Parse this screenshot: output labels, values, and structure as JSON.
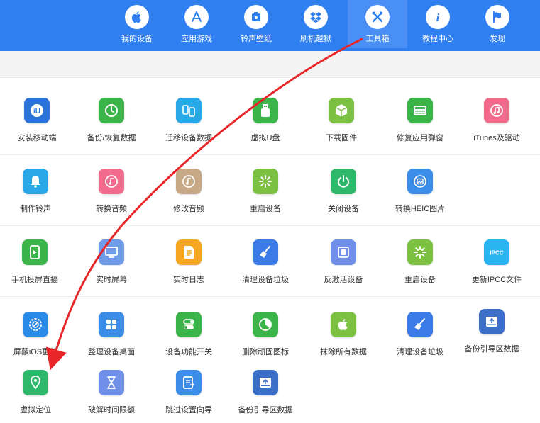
{
  "nav": {
    "tabs": [
      {
        "label": "我的设备",
        "icon": "apple-icon",
        "active": false
      },
      {
        "label": "应用游戏",
        "icon": "app-store-icon",
        "active": false
      },
      {
        "label": "铃声壁纸",
        "icon": "ringtone-icon",
        "active": false
      },
      {
        "label": "刷机越狱",
        "icon": "dropbox-icon",
        "active": false
      },
      {
        "label": "工具箱",
        "icon": "tools-icon",
        "active": true
      },
      {
        "label": "教程中心",
        "icon": "info-icon",
        "active": false
      },
      {
        "label": "发现",
        "icon": "flag-icon",
        "active": false
      }
    ],
    "brand_color": "#2f7ff0"
  },
  "tools": {
    "rows": [
      [
        {
          "label": "安装移动端",
          "icon": "iu-app-icon",
          "color": "#2a73d8"
        },
        {
          "label": "备份/恢复数据",
          "icon": "clock-restore-icon",
          "color": "#3bb54a"
        },
        {
          "label": "迁移设备数据",
          "icon": "phone-transfer-icon",
          "color": "#29a8e8"
        },
        {
          "label": "虚拟U盘",
          "icon": "usb-icon",
          "color": "#3bb54a"
        },
        {
          "label": "下载固件",
          "icon": "cube-icon",
          "color": "#7cc142"
        },
        {
          "label": "修复应用弹窗",
          "icon": "apple-id-icon",
          "color": "#3bb54a"
        },
        {
          "label": "iTunes及驱动",
          "icon": "itunes-icon",
          "color": "#f06b8c"
        }
      ],
      [
        {
          "label": "制作铃声",
          "icon": "bell-icon",
          "color": "#29a8e8"
        },
        {
          "label": "转换音频",
          "icon": "music-icon",
          "color": "#f06b8c"
        },
        {
          "label": "修改音频",
          "icon": "music-edit-icon",
          "color": "#c8a987"
        },
        {
          "label": "重启设备",
          "icon": "restart-burst-icon",
          "color": "#7cc142"
        },
        {
          "label": "关闭设备",
          "icon": "power-icon",
          "color": "#2db86b"
        },
        {
          "label": "转换HEIC图片",
          "icon": "image-convert-icon",
          "color": "#3b8de8"
        }
      ],
      [
        {
          "label": "手机投屏直播",
          "icon": "screen-cast-icon",
          "color": "#3bb54a"
        },
        {
          "label": "实时屏幕",
          "icon": "monitor-icon",
          "color": "#6f9be8"
        },
        {
          "label": "实时日志",
          "icon": "log-icon",
          "color": "#f5a623"
        },
        {
          "label": "清理设备垃圾",
          "icon": "broom-icon",
          "color": "#3b7be8"
        },
        {
          "label": "反激活设备",
          "icon": "deactivate-icon",
          "color": "#6f8fe8"
        },
        {
          "label": "重启设备",
          "icon": "restart-burst-icon",
          "color": "#7cc142"
        },
        {
          "label": "更新IPCC文件",
          "icon": "ipcc-icon",
          "color": "#29b6f0",
          "text": "IPCC"
        }
      ],
      [
        {
          "label": "屏蔽iOS更新",
          "icon": "block-update-icon",
          "color": "#2a8ae8"
        },
        {
          "label": "整理设备桌面",
          "icon": "grid-icon",
          "color": "#3b8de8"
        },
        {
          "label": "设备功能开关",
          "icon": "toggle-icon",
          "color": "#3bb54a"
        },
        {
          "label": "删除顽固图标",
          "icon": "pie-icon",
          "color": "#3bb54a"
        },
        {
          "label": "抹除所有数据",
          "icon": "apple-erase-icon",
          "color": "#7cc142"
        },
        {
          "label": "清理设备垃圾",
          "icon": "broom-icon",
          "color": "#3b7be8"
        },
        {
          "label": "备份引导区数据",
          "icon": "disk-backup-icon",
          "color": "#3b6fc8"
        }
      ],
      [
        {
          "label": "虚拟定位",
          "icon": "location-pin-icon",
          "color": "#2db86b"
        },
        {
          "label": "破解时间限额",
          "icon": "hourglass-icon",
          "color": "#6f8fe8"
        },
        {
          "label": "跳过设置向导",
          "icon": "skip-setup-icon",
          "color": "#3b8de8"
        },
        {
          "label": "备份引导区数据",
          "icon": "disk-backup-icon",
          "color": "#3b6fc8"
        }
      ]
    ]
  },
  "annotation": {
    "color": "#e8262a"
  }
}
